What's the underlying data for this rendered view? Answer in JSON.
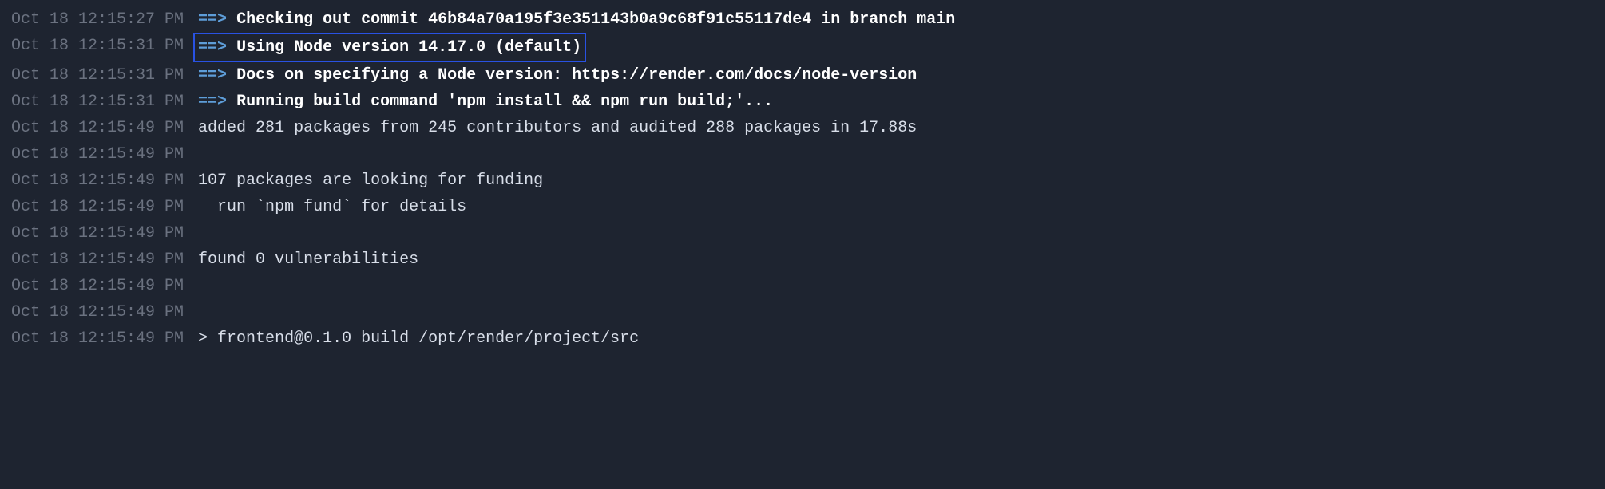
{
  "logs": [
    {
      "ts": "Oct 18 12:15:27 PM",
      "arrow": "==>",
      "bold": "Checking out commit 46b84a70a195f3e351143b0a9c68f91c55117de4 in branch main",
      "msg": "",
      "highlighted": false
    },
    {
      "ts": "Oct 18 12:15:31 PM",
      "arrow": "==>",
      "bold": "Using Node version 14.17.0 (default)",
      "msg": "",
      "highlighted": true
    },
    {
      "ts": "Oct 18 12:15:31 PM",
      "arrow": "==>",
      "bold": "Docs on specifying a Node version: https://render.com/docs/node-version",
      "msg": "",
      "highlighted": false
    },
    {
      "ts": "Oct 18 12:15:31 PM",
      "arrow": "==>",
      "bold": "Running build command 'npm install && npm run build;'...",
      "msg": "",
      "highlighted": false
    },
    {
      "ts": "Oct 18 12:15:49 PM",
      "arrow": "",
      "bold": "",
      "msg": "added 281 packages from 245 contributors and audited 288 packages in 17.88s",
      "highlighted": false
    },
    {
      "ts": "Oct 18 12:15:49 PM",
      "arrow": "",
      "bold": "",
      "msg": "",
      "highlighted": false
    },
    {
      "ts": "Oct 18 12:15:49 PM",
      "arrow": "",
      "bold": "",
      "msg": "107 packages are looking for funding",
      "highlighted": false
    },
    {
      "ts": "Oct 18 12:15:49 PM",
      "arrow": "",
      "bold": "",
      "msg": "  run `npm fund` for details",
      "highlighted": false
    },
    {
      "ts": "Oct 18 12:15:49 PM",
      "arrow": "",
      "bold": "",
      "msg": "",
      "highlighted": false
    },
    {
      "ts": "Oct 18 12:15:49 PM",
      "arrow": "",
      "bold": "",
      "msg": "found 0 vulnerabilities",
      "highlighted": false
    },
    {
      "ts": "Oct 18 12:15:49 PM",
      "arrow": "",
      "bold": "",
      "msg": "",
      "highlighted": false
    },
    {
      "ts": "Oct 18 12:15:49 PM",
      "arrow": "",
      "bold": "",
      "msg": "",
      "highlighted": false
    },
    {
      "ts": "Oct 18 12:15:49 PM",
      "arrow": "",
      "bold": "",
      "msg": "> frontend@0.1.0 build /opt/render/project/src",
      "highlighted": false
    }
  ]
}
